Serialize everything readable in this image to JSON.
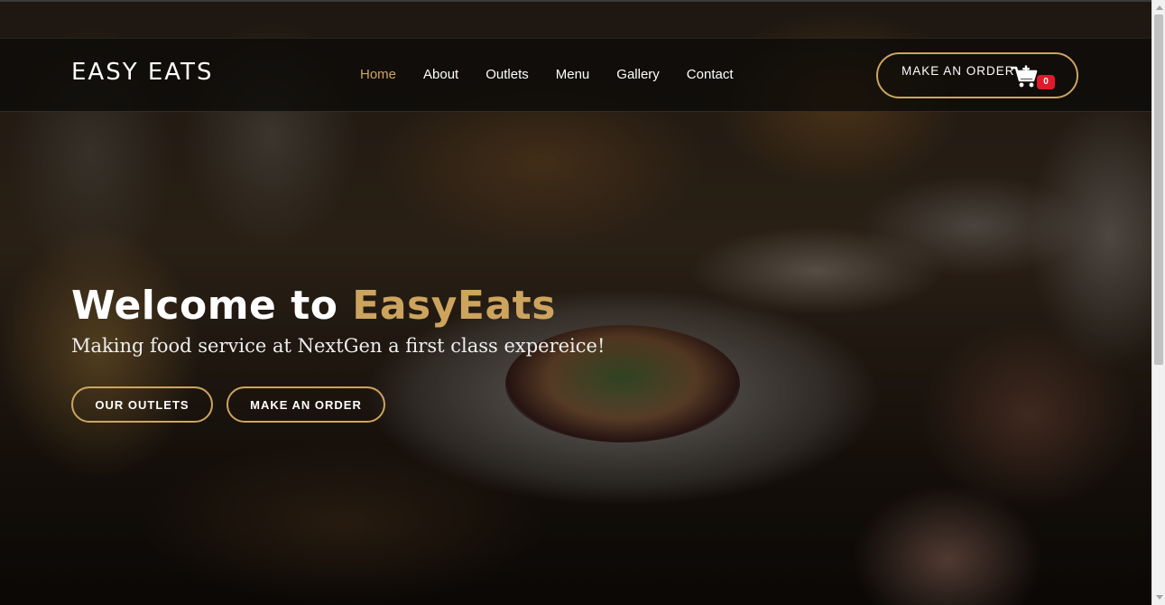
{
  "brand": {
    "name": "EASY EATS"
  },
  "nav": {
    "items": [
      {
        "label": "Home",
        "active": true
      },
      {
        "label": "About"
      },
      {
        "label": "Outlets"
      },
      {
        "label": "Menu"
      },
      {
        "label": "Gallery"
      },
      {
        "label": "Contact"
      }
    ]
  },
  "header_cta": {
    "label": "MAKE AN ORDER",
    "cart_icon": "cart-plus-icon",
    "cart_count": "0"
  },
  "hero": {
    "title_prefix": "Welcome to ",
    "title_accent": "EasyEats",
    "subtitle": "Making food service at NextGen a first class expereice!",
    "buttons": {
      "outlets": "OUR OUTLETS",
      "order": "MAKE AN ORDER"
    }
  },
  "colors": {
    "accent": "#cda45e",
    "badge": "#e01a2b",
    "text": "#ffffff"
  }
}
